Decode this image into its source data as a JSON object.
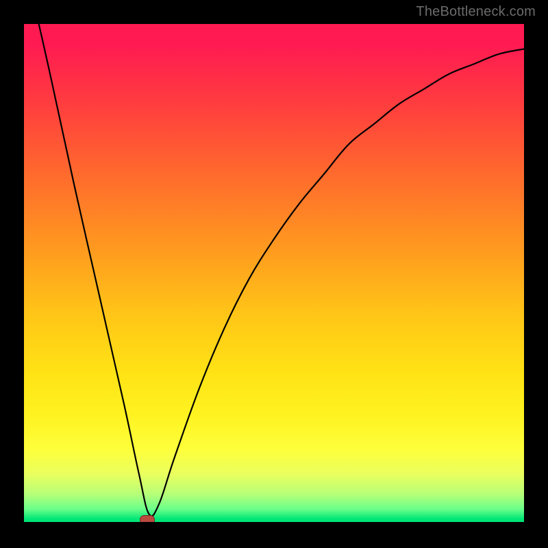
{
  "watermark": "TheBottleneck.com",
  "chart_data": {
    "type": "line",
    "title": "",
    "xlabel": "",
    "ylabel": "",
    "xlim": [
      0,
      100
    ],
    "ylim": [
      0,
      100
    ],
    "grid": false,
    "background_gradient": {
      "direction": "vertical",
      "stops": [
        {
          "pos": 0.0,
          "color": "#ff1a52"
        },
        {
          "pos": 0.15,
          "color": "#ff3a40"
        },
        {
          "pos": 0.3,
          "color": "#ff6a2d"
        },
        {
          "pos": 0.45,
          "color": "#ff9a1f"
        },
        {
          "pos": 0.58,
          "color": "#ffc517"
        },
        {
          "pos": 0.7,
          "color": "#ffe315"
        },
        {
          "pos": 0.85,
          "color": "#feff3a"
        },
        {
          "pos": 0.94,
          "color": "#b7ff78"
        },
        {
          "pos": 1.0,
          "color": "#00e676"
        }
      ]
    },
    "baseline_y": 0,
    "series": [
      {
        "name": "bottleneck-curve",
        "x": [
          0,
          5,
          10,
          15,
          20,
          23,
          25,
          27,
          30,
          35,
          40,
          45,
          50,
          55,
          60,
          65,
          70,
          75,
          80,
          85,
          90,
          95,
          100
        ],
        "y": [
          113,
          91,
          68,
          46,
          24,
          10,
          2,
          4,
          13,
          27,
          39,
          49,
          57,
          64,
          70,
          76,
          80,
          84,
          87,
          90,
          92,
          94,
          95
        ],
        "color": "#000000",
        "stroke_width": 2
      }
    ],
    "marker": {
      "x": 24.5,
      "y": 1.0,
      "width_pct": 2.8,
      "height_pct": 1.6,
      "radius_pct": 0.9,
      "color": "#bb4a3e"
    }
  }
}
